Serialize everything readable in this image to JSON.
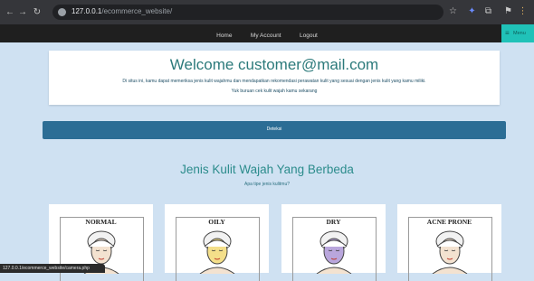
{
  "browser": {
    "url_host": "127.0.0.1",
    "url_path": "/ecommerce_website/",
    "status_url": "127.0.0.1/ecommerce_website/camera.php"
  },
  "site_nav": {
    "items": [
      "Home",
      "My Account",
      "Logout"
    ],
    "menu_label": "Menu"
  },
  "welcome": {
    "title": "Welcome customer@mail.com",
    "description": "Di situs ini, kamu dapat memeriksa jenis kulit wajahmu dan mendapatkan rekomendasi perawatan kulit yang sesuai dengan jenis kulit yang kamu miliki.",
    "subtitle": "Yuk buruan cek kulit wajah kamu sekarang"
  },
  "detect_button": "Deteksi",
  "section": {
    "title": "Jenis Kulit Wajah Yang Berbeda",
    "subtitle": "Apa tipe jenis kulitmu?"
  },
  "skin_cards": [
    {
      "label": "NORMAL",
      "face_color": "#f3e2d0"
    },
    {
      "label": "OILY",
      "face_color": "#f4df8a"
    },
    {
      "label": "DRY",
      "face_color": "#b9a6dc"
    },
    {
      "label": "ACNE PRONE",
      "face_color": "#f3e2d0"
    }
  ],
  "colors": {
    "background": "#cfe1f2",
    "accent": "#2c8c8c",
    "button": "#2c6d95",
    "menu": "#20c2b8"
  }
}
